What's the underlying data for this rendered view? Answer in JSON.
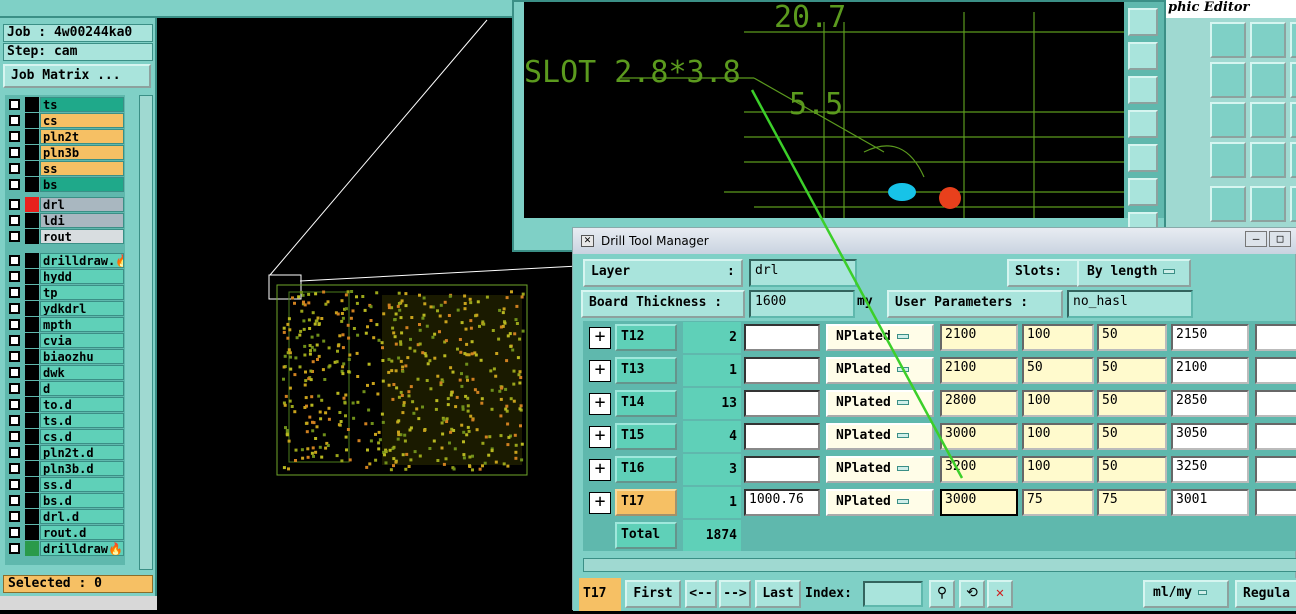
{
  "left_panel": {
    "job": "Job : 4w00244ka0",
    "step": "Step: cam",
    "job_matrix_button": "Job Matrix ...",
    "layers": [
      {
        "name": "ts",
        "row_color": "#1fa98a",
        "swatch": "#000000"
      },
      {
        "name": "cs",
        "row_color": "#f6c064",
        "swatch": "#000000"
      },
      {
        "name": "pln2t",
        "row_color": "#f6c064",
        "swatch": "#000000"
      },
      {
        "name": "pln3b",
        "row_color": "#f6c064",
        "swatch": "#000000"
      },
      {
        "name": "ss",
        "row_color": "#f6c064",
        "swatch": "#000000"
      },
      {
        "name": "bs",
        "row_color": "#1fa98a",
        "swatch": "#000000"
      },
      {
        "name": "drl",
        "row_color": "#a9b7c0",
        "swatch": "#e8201c"
      },
      {
        "name": "ldi",
        "row_color": "#a9b7c0",
        "swatch": "#000000"
      },
      {
        "name": "rout",
        "row_color": "#d8dde0",
        "swatch": "#000000"
      },
      {
        "name": "drilldraw.🔥",
        "row_color": "#5fd0b8",
        "swatch": "#000000"
      },
      {
        "name": "hydd",
        "row_color": "#5fd0b8",
        "swatch": "#000000"
      },
      {
        "name": "tp",
        "row_color": "#5fd0b8",
        "swatch": "#000000"
      },
      {
        "name": "ydkdrl",
        "row_color": "#5fd0b8",
        "swatch": "#000000"
      },
      {
        "name": "mpth",
        "row_color": "#5fd0b8",
        "swatch": "#000000"
      },
      {
        "name": "cvia",
        "row_color": "#5fd0b8",
        "swatch": "#000000"
      },
      {
        "name": "biaozhu",
        "row_color": "#5fd0b8",
        "swatch": "#000000"
      },
      {
        "name": "dwk",
        "row_color": "#5fd0b8",
        "swatch": "#000000"
      },
      {
        "name": "d",
        "row_color": "#5fd0b8",
        "swatch": "#000000"
      },
      {
        "name": "to.d",
        "row_color": "#5fd0b8",
        "swatch": "#000000"
      },
      {
        "name": "ts.d",
        "row_color": "#5fd0b8",
        "swatch": "#000000"
      },
      {
        "name": "cs.d",
        "row_color": "#5fd0b8",
        "swatch": "#000000"
      },
      {
        "name": "pln2t.d",
        "row_color": "#5fd0b8",
        "swatch": "#000000"
      },
      {
        "name": "pln3b.d",
        "row_color": "#5fd0b8",
        "swatch": "#000000"
      },
      {
        "name": "ss.d",
        "row_color": "#5fd0b8",
        "swatch": "#000000"
      },
      {
        "name": "bs.d",
        "row_color": "#5fd0b8",
        "swatch": "#000000"
      },
      {
        "name": "drl.d",
        "row_color": "#5fd0b8",
        "swatch": "#000000"
      },
      {
        "name": "rout.d",
        "row_color": "#5fd0b8",
        "swatch": "#000000"
      },
      {
        "name": "drilldraw🔥",
        "row_color": "#5fd0b8",
        "swatch": "#2a9a4a"
      }
    ],
    "selected": "Selected : 0"
  },
  "zoom_view": {
    "dim_1": "20.7",
    "slot_label": "SLOT 2.8*3.8",
    "dim_2": "5.5"
  },
  "graphic_editor": {
    "title": "phic Editor"
  },
  "drill_manager": {
    "title": "Drill Tool Manager",
    "layer_label": "Layer",
    "layer_colon": ":",
    "layer_value": "drl",
    "slots_label": "Slots:",
    "slots_value": "By length",
    "board_thickness_label": "Board Thickness :",
    "board_thickness_value": "1600",
    "board_thickness_unit": "my",
    "user_params_label": "User Parameters :",
    "user_params_value": "no_hasl",
    "rows": [
      {
        "tool": "T12",
        "count": "2",
        "field": "",
        "type": "NPlated",
        "c1": "2100",
        "c2": "100",
        "c3": "50",
        "c4": "2150",
        "active": false
      },
      {
        "tool": "T13",
        "count": "1",
        "field": "",
        "type": "NPlated",
        "c1": "2100",
        "c2": "50",
        "c3": "50",
        "c4": "2100",
        "active": false
      },
      {
        "tool": "T14",
        "count": "13",
        "field": "",
        "type": "NPlated",
        "c1": "2800",
        "c2": "100",
        "c3": "50",
        "c4": "2850",
        "active": false
      },
      {
        "tool": "T15",
        "count": "4",
        "field": "",
        "type": "NPlated",
        "c1": "3000",
        "c2": "100",
        "c3": "50",
        "c4": "3050",
        "active": false
      },
      {
        "tool": "T16",
        "count": "3",
        "field": "",
        "type": "NPlated",
        "c1": "3200",
        "c2": "100",
        "c3": "50",
        "c4": "3250",
        "active": false
      },
      {
        "tool": "T17",
        "count": "1",
        "field": "1000.76",
        "type": "NPlated",
        "c1": "3000",
        "c2": "75",
        "c3": "75",
        "c4": "3001",
        "active": true
      }
    ],
    "total_label": "Total",
    "total_value": "1874",
    "bottom": {
      "current_tool": "T17",
      "first": "First",
      "prev": "<--",
      "next": "-->",
      "last": "Last",
      "index_label": "Index:",
      "index_value": "",
      "units": "ml/my",
      "regula": "Regula"
    }
  }
}
